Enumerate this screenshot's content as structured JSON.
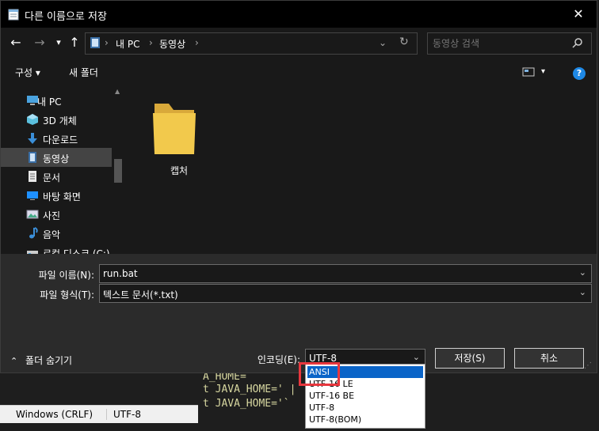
{
  "window": {
    "title": "다른 이름으로 저장",
    "close": "✕"
  },
  "nav": {
    "back": "←",
    "forward": "→",
    "recent": "▾",
    "up": "↑",
    "breadcrumb": [
      "내 PC",
      "동영상"
    ],
    "refresh": "↻",
    "search_placeholder": "동영상 검색"
  },
  "toolbar": {
    "organize": "구성 ▾",
    "new_folder": "새 폴더",
    "view": "▾",
    "help": "?"
  },
  "sidebar": {
    "items": [
      {
        "label": "내 PC",
        "icon": "pc-icon"
      },
      {
        "label": "3D 개체",
        "icon": "cube-icon"
      },
      {
        "label": "다운로드",
        "icon": "download-icon"
      },
      {
        "label": "동영상",
        "icon": "video-icon",
        "selected": true
      },
      {
        "label": "문서",
        "icon": "document-icon"
      },
      {
        "label": "바탕 화면",
        "icon": "desktop-icon"
      },
      {
        "label": "사진",
        "icon": "picture-icon"
      },
      {
        "label": "음악",
        "icon": "music-icon"
      },
      {
        "label": "로컬 디스크 (C:)",
        "icon": "drive-icon"
      }
    ]
  },
  "content": {
    "folders": [
      {
        "name": "캡처"
      }
    ]
  },
  "form": {
    "filename_label": "파일 이름(N):",
    "filename_value": "run.bat",
    "filetype_label": "파일 형식(T):",
    "filetype_value": "텍스트 문서(*.txt)",
    "hide_folders": "폴더 숨기기",
    "encoding_label": "인코딩(E):",
    "encoding_value": "UTF-8",
    "save_button": "저장(S)",
    "cancel_button": "취소"
  },
  "encoding_options": [
    "ANSI",
    "UTF-16 LE",
    "UTF-16 BE",
    "UTF-8",
    "UTF-8(BOM)"
  ],
  "selected_encoding_option": "ANSI",
  "background": {
    "code_lines": [
      "A_HOME=",
      "t JAVA_HOME=' |",
      "t JAVA_HOME='`"
    ],
    "status_line_ending": "Windows (CRLF)",
    "status_encoding": "UTF-8"
  },
  "colors": {
    "accent": "#0a64c8",
    "highlight_box": "#e8373e",
    "folder": "#f2c94c"
  }
}
